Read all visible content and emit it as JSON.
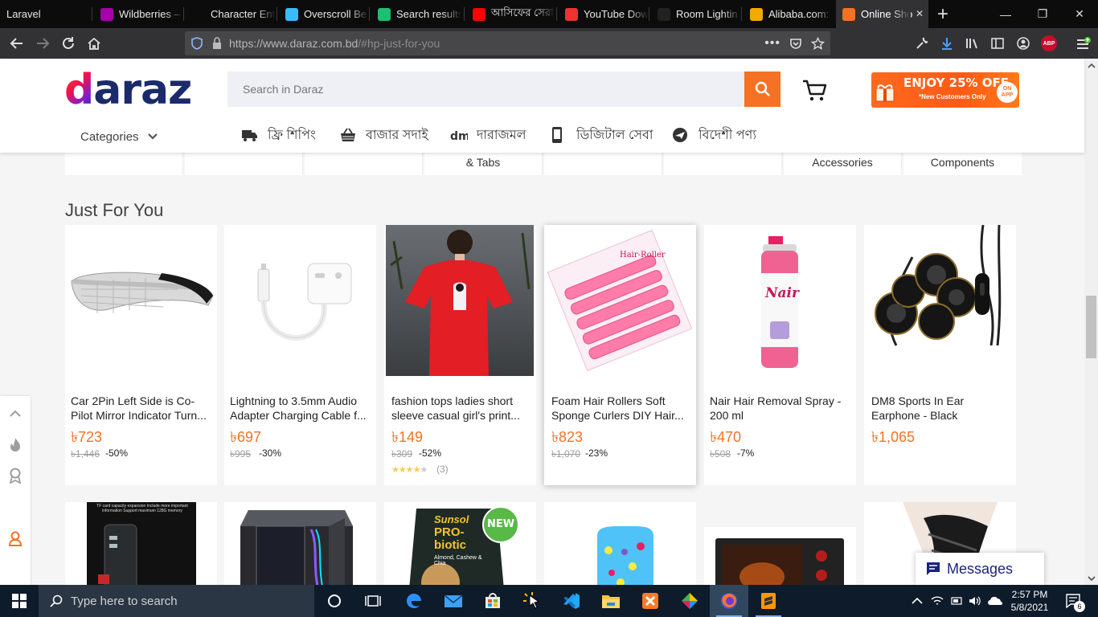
{
  "browser": {
    "tabs": [
      {
        "label": "Laravel",
        "icon": "laravel-icon",
        "color": "#0c0c0d"
      },
      {
        "label": "Wildberries –",
        "icon": "wildberries-icon",
        "color": "#a800a8"
      },
      {
        "label": "Character Entity R",
        "icon": "blank-icon",
        "color": "#0c0c0d"
      },
      {
        "label": "Overscroll Be",
        "icon": "tailwind-icon",
        "color": "#38bdf8"
      },
      {
        "label": "Search results",
        "icon": "vuetify-icon",
        "color": "#1dbf73"
      },
      {
        "label": "আসিফের সেরা",
        "icon": "youtube-icon",
        "color": "#ff0000"
      },
      {
        "label": "YouTube Dow",
        "icon": "download-icon",
        "color": "#e33"
      },
      {
        "label": "Room Lightin",
        "icon": "amazon-icon",
        "color": "#222"
      },
      {
        "label": "Alibaba.com:",
        "icon": "alibaba-icon",
        "color": "#f2a900"
      },
      {
        "label": "Online Sho",
        "icon": "daraz-icon",
        "color": "#f57224"
      }
    ],
    "new_tab": "+",
    "url": "https://www.daraz.com.bd/#hp-just-for-you",
    "url_host": "https://www.daraz.com.bd",
    "url_rest": "/#hp-just-for-you",
    "abp_label": "ABP"
  },
  "header": {
    "logo": "daraz",
    "search_placeholder": "Search in Daraz",
    "promo_title": "ENJOY 25% OFF",
    "promo_sub": "*New Customers Only",
    "promo_badge": "ON APP",
    "categories_label": "Categories",
    "nav": [
      {
        "label": "ফ্রি শিপিং",
        "icon": "free-shipping-icon"
      },
      {
        "label": "বাজার সদাই",
        "icon": "basket-icon"
      },
      {
        "label": "দারাজমল",
        "icon": "darazmall-icon"
      },
      {
        "label": "ডিজিটাল সেবা",
        "icon": "mobile-icon"
      },
      {
        "label": "বিদেশী পণ্য",
        "icon": "plane-icon"
      }
    ]
  },
  "category_strip": [
    "",
    "",
    "",
    "& Tabs",
    "",
    "",
    "Accessories",
    "Components"
  ],
  "section_title": "Just For You",
  "products": [
    {
      "title": "Car 2Pin Left Side is Co-Pilot Mirror Indicator Turn...",
      "price": "৳723",
      "original": "৳1,446",
      "discount": "-50%"
    },
    {
      "title": "Lightning to 3.5mm Audio Adapter Charging Cable f...",
      "price": "৳697",
      "original": "৳995",
      "discount": "-30%"
    },
    {
      "title": "fashion tops ladies short sleeve casual girl's print...",
      "price": "৳149",
      "original": "৳309",
      "discount": "-52%",
      "rating": 4,
      "reviews": "(3)"
    },
    {
      "title": "Foam Hair Rollers Soft Sponge Curlers DIY Hair...",
      "price": "৳823",
      "original": "৳1,070",
      "discount": "-23%"
    },
    {
      "title": "Nair Hair Removal Spray - 200 ml",
      "price": "৳470",
      "original": "৳508",
      "discount": "-7%"
    },
    {
      "title": "DM8 Sports In Ear Earphone - Black",
      "price": "৳1,065",
      "original": "",
      "discount": ""
    }
  ],
  "row2_labels": {
    "tf_text": "TF card capacity expansion Include more important information Support maximum 128G memory",
    "new_badge": "NEW",
    "sunsol_brand": "Sunsol",
    "sunsol_name": "PRO-biotic",
    "sunsol_sub": "Almond, Cashew & Chia"
  },
  "messages_label": "Messages",
  "taskbar": {
    "search_placeholder": "Type here to search",
    "time": "2:57 PM",
    "date": "5/8/2021",
    "notification_count": "6"
  },
  "colors": {
    "accent": "#f57224",
    "brand_blue": "#1a2a6c"
  }
}
